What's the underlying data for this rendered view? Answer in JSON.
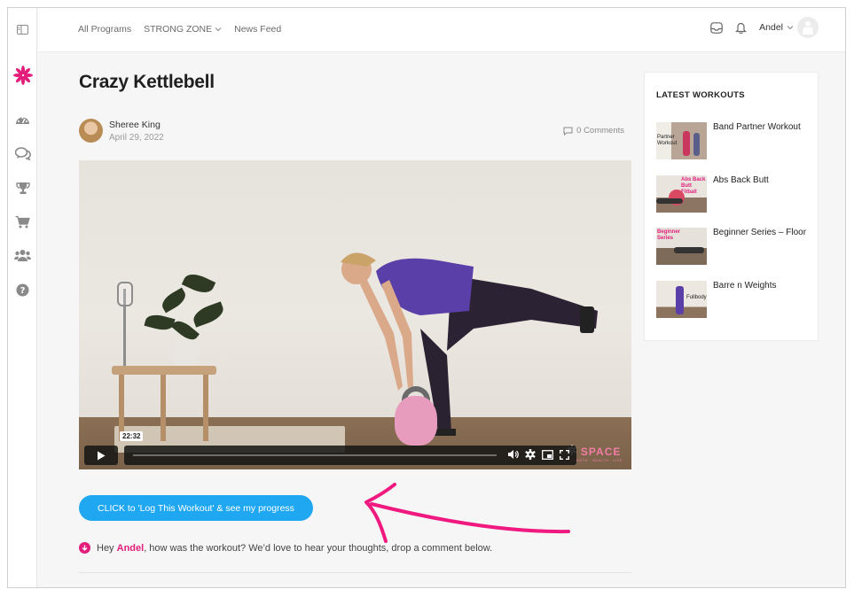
{
  "nav": {
    "items": [
      {
        "label": "All Programs"
      },
      {
        "label": "STRONG ZONE",
        "has_dropdown": true
      },
      {
        "label": "News Feed"
      }
    ]
  },
  "user": {
    "name": "Andel"
  },
  "rail_icons": [
    "sidebar-toggle-icon",
    "logo-flower-icon",
    "dashboard-icon",
    "chat-icon",
    "trophy-icon",
    "cart-icon",
    "group-icon",
    "help-icon"
  ],
  "post": {
    "title": "Crazy Kettlebell",
    "author": "Sheree King",
    "date": "April 29, 2022",
    "comments": "0 Comments"
  },
  "video": {
    "timestamp": "22:32",
    "watermark": "SPACE",
    "watermark_sub": "STRENGTH · HEALTH · LIFE",
    "progress": 0.0
  },
  "cta": {
    "label": "CLICK to 'Log This Workout' & see my progress"
  },
  "prompt": {
    "prefix": "Hey ",
    "name": "Andel",
    "suffix": ", how was the workout? We’d love to hear your thoughts, drop a comment below."
  },
  "sidebar": {
    "title": "LATEST WORKOUTS",
    "workouts": [
      {
        "name": "Band Partner Workout",
        "thumb_text": "Partner Workout"
      },
      {
        "name": "Abs Back Butt",
        "thumb_text": "Abs Back Butt Fitball"
      },
      {
        "name": "Beginner Series – Floor",
        "thumb_text": "Beginner Series"
      },
      {
        "name": "Barre n Weights",
        "thumb_text": "Fullbody"
      }
    ]
  },
  "colors": {
    "accent": "#e21d7a",
    "button": "#1fa7f1",
    "rail_icon": "#8a8a8a"
  }
}
